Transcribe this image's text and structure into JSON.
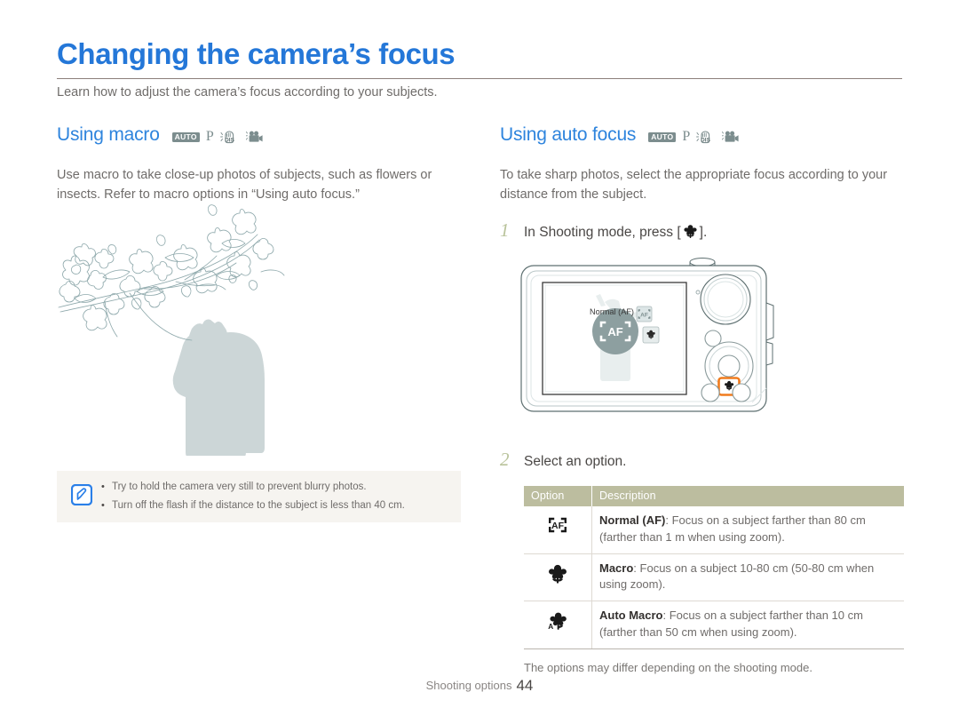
{
  "page": {
    "title": "Changing the camera’s focus",
    "subtitle": "Learn how to adjust the camera’s focus according to your subjects.",
    "title_color": "#2477d8",
    "footer_label": "Shooting options",
    "footer_page": "44"
  },
  "mode_icons": [
    {
      "name": "auto-mode-icon",
      "label": "AUTO"
    },
    {
      "name": "program-mode-icon",
      "label": "P"
    },
    {
      "name": "dis-mode-icon",
      "label": "DIS"
    },
    {
      "name": "movie-mode-icon",
      "label": "Movie"
    }
  ],
  "left_column": {
    "heading": "Using macro",
    "body": "Use macro to take close-up photos of subjects, such as flowers or insects. Refer to macro options in “Using auto focus.”",
    "illustration_alt": "Person photographing a magnolia branch",
    "note": {
      "icon": "note-pencil-icon",
      "items": [
        "Try to hold the camera very still to prevent blurry photos.",
        "Turn off the flash if the distance to the subject is less than 40 cm."
      ]
    }
  },
  "right_column": {
    "heading": "Using auto focus",
    "body": "To take sharp photos, select the appropriate focus according to your distance from the subject.",
    "steps": [
      {
        "num": "1",
        "text_before": "In Shooting mode, press [",
        "icon": "macro-flower-icon",
        "text_after": "]."
      },
      {
        "num": "2",
        "text_before": "Select an option.",
        "icon": "",
        "text_after": ""
      }
    ],
    "camera": {
      "screen_label": "Normal (AF)",
      "screen_icon": "af-bracket-icon",
      "osd_buttons": [
        "af-bracket-icon",
        "macro-flower-icon"
      ],
      "highlighted_button": "macro-button",
      "highlight_color": "#f07b1d"
    },
    "table": {
      "headers": [
        "Option",
        "Description"
      ],
      "rows": [
        {
          "icon": "af-bracket-icon",
          "term": "Normal (AF)",
          "desc": ": Focus on a subject farther than 80 cm (farther than 1 m when using zoom)."
        },
        {
          "icon": "macro-flower-icon",
          "term": "Macro",
          "desc": ": Focus on a subject 10-80 cm (50-80 cm when using zoom)."
        },
        {
          "icon": "auto-macro-flower-icon",
          "term": "Auto Macro",
          "desc": ": Focus on a subject farther than 10 cm (farther than 50 cm when using zoom)."
        }
      ],
      "caption": "The options may differ depending on the shooting mode."
    }
  }
}
